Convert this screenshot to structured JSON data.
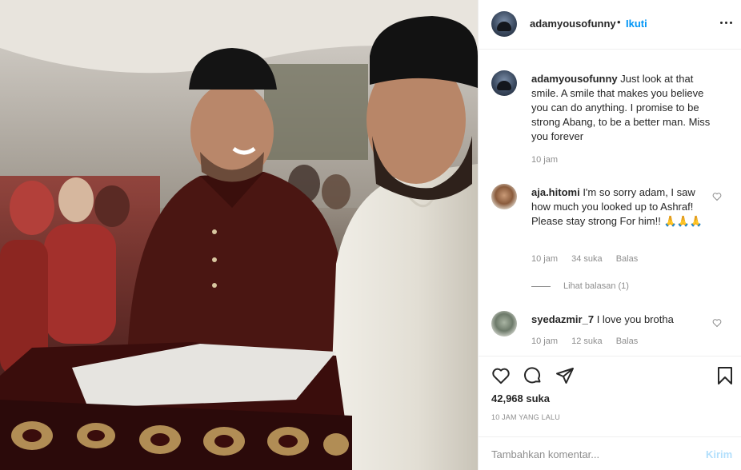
{
  "post": {
    "username": "adamyousofunny",
    "separator": "•",
    "follow_label": "Ikuti",
    "more_icon": "more-options-icon"
  },
  "caption": {
    "username": "adamyousofunny",
    "text": "Just look at that smile. A smile that makes you believe you can do anything. I promise to be strong Abang, to be a better man. Miss you forever",
    "time": "10 jam"
  },
  "comments": [
    {
      "username": "aja.hitomi",
      "text": "I'm so sorry adam, I saw how much you looked up to Ashraf! Please stay strong For him!! 🙏🙏🙏",
      "time": "10 jam",
      "likes": "34 suka",
      "reply": "Balas",
      "view_replies": "Lihat balasan (1)"
    },
    {
      "username": "syedazmir_7",
      "text": "I love you brotha",
      "time": "10 jam",
      "likes": "12 suka",
      "reply": "Balas"
    }
  ],
  "actions": {
    "likes_count": "42,968 suka",
    "time_ago": "10 JAM YANG LALU",
    "comment_placeholder": "Tambahkan komentar...",
    "post_label": "Kirim"
  },
  "colors": {
    "accent": "#0095f6",
    "accent_disabled": "#b2dffc",
    "text": "#262626",
    "muted": "#8e8e8e",
    "border": "#efefef"
  }
}
